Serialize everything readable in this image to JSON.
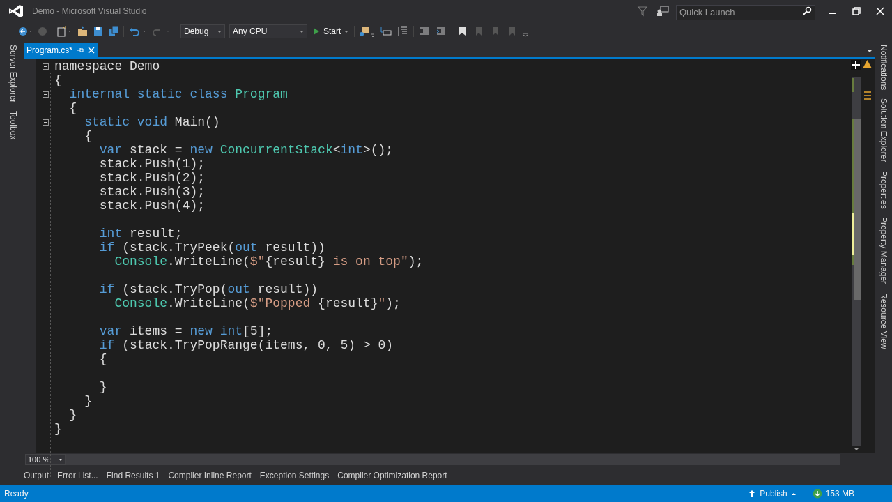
{
  "window": {
    "title": "Demo - Microsoft Visual Studio"
  },
  "quick_launch": {
    "placeholder": "Quick Launch"
  },
  "toolbar": {
    "configuration": "Debug",
    "platform": "Any CPU",
    "start": "Start"
  },
  "left_tabs": [
    "Server Explorer",
    "Toolbox"
  ],
  "right_tabs": [
    "Notifications",
    "Solution Explorer",
    "Properties",
    "Property Manager",
    "Resource View"
  ],
  "doc_tabs": [
    {
      "label": "Program.cs*",
      "selected": true
    }
  ],
  "code_lines": [
    {
      "kind": "code",
      "fold": true,
      "tokens": [
        {
          "kind": "plain",
          "t": "namespace Demo"
        }
      ]
    },
    {
      "kind": "code",
      "fold": false,
      "tokens": [
        {
          "kind": "plain",
          "t": "{"
        }
      ]
    },
    {
      "kind": "code",
      "fold": true,
      "tokens": [
        {
          "kind": "kw",
          "t": "  internal static class "
        },
        {
          "kind": "type",
          "t": "Program"
        }
      ]
    },
    {
      "kind": "code",
      "fold": false,
      "tokens": [
        {
          "kind": "plain",
          "t": "  {"
        }
      ]
    },
    {
      "kind": "code",
      "fold": true,
      "tokens": [
        {
          "kind": "kw",
          "t": "    static void "
        },
        {
          "kind": "plain",
          "t": "Main()"
        }
      ]
    },
    {
      "kind": "code",
      "fold": false,
      "tokens": [
        {
          "kind": "plain",
          "t": "    {"
        }
      ]
    },
    {
      "kind": "code",
      "fold": false,
      "tokens": [
        {
          "kind": "kw",
          "t": "      var"
        },
        {
          "kind": "plain",
          "t": " stack = "
        },
        {
          "kind": "kw",
          "t": "new "
        },
        {
          "kind": "type",
          "t": "ConcurrentStack"
        },
        {
          "kind": "plain",
          "t": "<"
        },
        {
          "kind": "kw",
          "t": "int"
        },
        {
          "kind": "plain",
          "t": ">();"
        }
      ]
    },
    {
      "kind": "code",
      "fold": false,
      "tokens": [
        {
          "kind": "plain",
          "t": "      stack.Push(1);"
        }
      ]
    },
    {
      "kind": "code",
      "fold": false,
      "tokens": [
        {
          "kind": "plain",
          "t": "      stack.Push(2);"
        }
      ]
    },
    {
      "kind": "code",
      "fold": false,
      "tokens": [
        {
          "kind": "plain",
          "t": "      stack.Push(3);"
        }
      ]
    },
    {
      "kind": "code",
      "fold": false,
      "tokens": [
        {
          "kind": "plain",
          "t": "      stack.Push(4);"
        }
      ]
    },
    {
      "kind": "blank"
    },
    {
      "kind": "code",
      "fold": false,
      "tokens": [
        {
          "kind": "kw",
          "t": "      int"
        },
        {
          "kind": "plain",
          "t": " result;"
        }
      ]
    },
    {
      "kind": "code",
      "fold": false,
      "tokens": [
        {
          "kind": "kw",
          "t": "      if"
        },
        {
          "kind": "plain",
          "t": " (stack.TryPeek("
        },
        {
          "kind": "kw",
          "t": "out"
        },
        {
          "kind": "plain",
          "t": " result))"
        }
      ]
    },
    {
      "kind": "code",
      "fold": false,
      "tokens": [
        {
          "kind": "type",
          "t": "        Console"
        },
        {
          "kind": "plain",
          "t": ".WriteLine("
        },
        {
          "kind": "str",
          "t": "$\""
        },
        {
          "kind": "plain",
          "t": "{result}"
        },
        {
          "kind": "str",
          "t": " is on top\""
        },
        {
          "kind": "plain",
          "t": ");"
        }
      ]
    },
    {
      "kind": "blank"
    },
    {
      "kind": "code",
      "fold": false,
      "tokens": [
        {
          "kind": "kw",
          "t": "      if"
        },
        {
          "kind": "plain",
          "t": " (stack.TryPop("
        },
        {
          "kind": "kw",
          "t": "out"
        },
        {
          "kind": "plain",
          "t": " result))"
        }
      ]
    },
    {
      "kind": "code",
      "fold": false,
      "tokens": [
        {
          "kind": "type",
          "t": "        Console"
        },
        {
          "kind": "plain",
          "t": ".WriteLine("
        },
        {
          "kind": "str",
          "t": "$\"Popped "
        },
        {
          "kind": "plain",
          "t": "{result}"
        },
        {
          "kind": "str",
          "t": "\""
        },
        {
          "kind": "plain",
          "t": ");"
        }
      ]
    },
    {
      "kind": "blank"
    },
    {
      "kind": "code",
      "fold": false,
      "tokens": [
        {
          "kind": "kw",
          "t": "      var"
        },
        {
          "kind": "plain",
          "t": " items = "
        },
        {
          "kind": "kw",
          "t": "new int"
        },
        {
          "kind": "plain",
          "t": "[5];"
        }
      ]
    },
    {
      "kind": "code",
      "fold": false,
      "tokens": [
        {
          "kind": "kw",
          "t": "      if"
        },
        {
          "kind": "plain",
          "t": " (stack.TryPopRange(items, 0, 5) > 0)"
        }
      ]
    },
    {
      "kind": "code",
      "fold": false,
      "tokens": [
        {
          "kind": "plain",
          "t": "      {"
        }
      ]
    },
    {
      "kind": "blank"
    },
    {
      "kind": "code",
      "fold": false,
      "tokens": [
        {
          "kind": "plain",
          "t": "      }"
        }
      ]
    },
    {
      "kind": "code",
      "fold": false,
      "tokens": [
        {
          "kind": "plain",
          "t": "    }"
        }
      ]
    },
    {
      "kind": "code",
      "fold": false,
      "tokens": [
        {
          "kind": "plain",
          "t": "  }"
        }
      ]
    },
    {
      "kind": "code",
      "fold": false,
      "tokens": [
        {
          "kind": "plain",
          "t": "}"
        }
      ]
    }
  ],
  "zoom": "100 %",
  "bottom_tabs": [
    "Output",
    "Error List...",
    "Find Results 1",
    "Compiler Inline Report",
    "Exception Settings",
    "Compiler Optimization Report"
  ],
  "status_bar": {
    "text": "Ready",
    "publish": "Publish",
    "memory": "153 MB"
  }
}
